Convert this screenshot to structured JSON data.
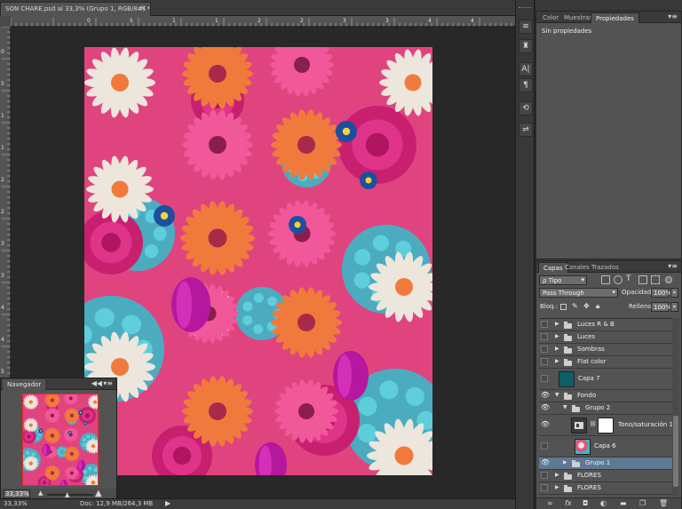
{
  "document": {
    "tab_title": "SON CHARE.psd al 33,3% (Grupo 1, RGB/8#) *",
    "tab_close": "×",
    "ruler_top_ticks": [
      "0",
      "5",
      "1",
      "1",
      "2",
      "2",
      "3",
      "3",
      "4",
      "4"
    ],
    "ruler_left_ticks": [
      "0",
      "5",
      "1",
      "1",
      "2",
      "2",
      "3",
      "3",
      "4",
      "4",
      "5",
      "5",
      "6"
    ],
    "status_zoom": "33,33%",
    "status_doc": "Doc: 12,9 MB/264,3 MB",
    "status_arrow": "▶"
  },
  "navigator": {
    "tab": "Navegador",
    "collapse": "◀◀",
    "menu": "▾≡",
    "zoom_value": "33,33%",
    "zoom_out_icon": "▲",
    "zoom_in_icon": "▲",
    "slider_knob": "▲",
    "zoom_level": 0.35,
    "frame_color": "#e02a2a"
  },
  "tools": [
    {
      "name": "grip-icon",
      "glyph": "⁞"
    },
    {
      "name": "brush-presets-icon",
      "glyph": "≋"
    },
    {
      "name": "clone-source-icon",
      "glyph": "♜"
    },
    {
      "name": "character-icon",
      "glyph": "A|"
    },
    {
      "name": "paragraph-icon",
      "glyph": "¶"
    },
    {
      "name": "history-icon",
      "glyph": "⟲"
    },
    {
      "name": "tool-presets-icon",
      "glyph": "⇌"
    }
  ],
  "properties_panel": {
    "tabs": [
      "Color",
      "Muestras",
      "Propiedades"
    ],
    "active_tab": "Propiedades",
    "message": "Sin propiedades",
    "menu": "▾≡"
  },
  "layers_panel": {
    "tabs": [
      "Capas",
      "Canales",
      "Trazados"
    ],
    "active_tab": "Capas",
    "menu": "▾≡",
    "filter_kind": "Tipo",
    "filter_search_icon": "ρ",
    "blend_mode": "Pass Through",
    "opacity_label": "Opacidad:",
    "opacity_value": "100%",
    "lock_label": "Bloq.:",
    "fill_label": "Relleno:",
    "fill_value": "100%",
    "layers": [
      {
        "name": "Luces R & B",
        "type": "group",
        "visible": false,
        "indent": 0,
        "expanded": false,
        "selected": false
      },
      {
        "name": "Luces",
        "type": "group",
        "visible": false,
        "indent": 0,
        "expanded": false,
        "selected": false
      },
      {
        "name": "Sombras",
        "type": "group",
        "visible": false,
        "indent": 0,
        "expanded": false,
        "selected": false
      },
      {
        "name": "Flat color",
        "type": "group",
        "visible": false,
        "indent": 0,
        "expanded": false,
        "selected": false
      },
      {
        "name": "Capa 7",
        "type": "fill",
        "visible": false,
        "indent": 0,
        "thumb_color": "#0f5e66",
        "selected": false
      },
      {
        "name": "Fondo",
        "type": "group",
        "visible": true,
        "indent": 0,
        "expanded": true,
        "selected": false
      },
      {
        "name": "Grupo 2",
        "type": "group",
        "visible": true,
        "indent": 1,
        "expanded": true,
        "selected": false
      },
      {
        "name": "Tono/saturación 1",
        "type": "adjustment",
        "visible": true,
        "indent": 2,
        "selected": false
      },
      {
        "name": "Capa 6",
        "type": "image",
        "visible": false,
        "indent": 2,
        "thumb_color": "#d9567f",
        "selected": false
      },
      {
        "name": "Grupo 1",
        "type": "group",
        "visible": true,
        "indent": 1,
        "expanded": false,
        "selected": true
      },
      {
        "name": "FLORES",
        "type": "group",
        "visible": false,
        "indent": 0,
        "expanded": false,
        "selected": false
      },
      {
        "name": "FLORES",
        "type": "group",
        "visible": false,
        "indent": 0,
        "expanded": false,
        "selected": false
      }
    ],
    "footer_buttons": [
      {
        "name": "link-layers-icon",
        "glyph": "∞"
      },
      {
        "name": "fx-icon",
        "glyph": "fx"
      },
      {
        "name": "add-mask-icon",
        "glyph": "◘"
      },
      {
        "name": "adjustment-layer-icon",
        "glyph": "◐"
      },
      {
        "name": "new-group-icon",
        "glyph": "▬"
      },
      {
        "name": "new-layer-icon",
        "glyph": "❐"
      },
      {
        "name": "delete-layer-icon",
        "glyph": "🗑"
      }
    ]
  },
  "colors": {
    "accent_selected": "#5f7893",
    "artwork_magenta": "#e0447f",
    "artwork_teal": "#3bb8c8",
    "artwork_orange": "#f07a3c",
    "artwork_white": "#ece6dc"
  }
}
